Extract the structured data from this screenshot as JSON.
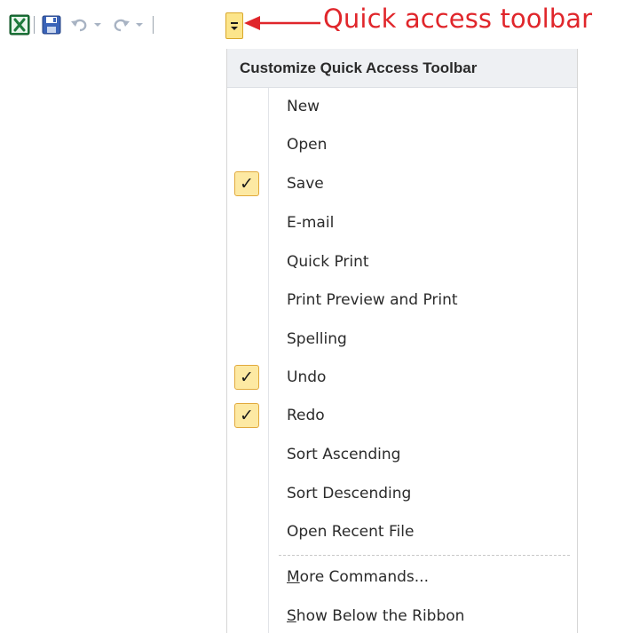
{
  "annotation": {
    "text": "Quick access toolbar",
    "color": "#e0262b"
  },
  "toolbar": {
    "icons": [
      "excel-icon",
      "save-icon",
      "undo-icon",
      "dropdown-arrow-icon",
      "redo-icon",
      "dropdown-arrow-icon",
      "customize-icon"
    ]
  },
  "menu": {
    "title": "Customize Quick Access Toolbar",
    "items": [
      {
        "label": "New",
        "checked": false
      },
      {
        "label": "Open",
        "checked": false
      },
      {
        "label": "Save",
        "checked": true
      },
      {
        "label": "E-mail",
        "checked": false
      },
      {
        "label": "Quick Print",
        "checked": false
      },
      {
        "label": "Print Preview and Print",
        "checked": false
      },
      {
        "label": "Spelling",
        "checked": false
      },
      {
        "label": "Undo",
        "checked": true
      },
      {
        "label": "Redo",
        "checked": true
      },
      {
        "label": "Sort Ascending",
        "checked": false
      },
      {
        "label": "Sort Descending",
        "checked": false
      },
      {
        "label": "Open Recent File",
        "checked": false
      }
    ],
    "more_commands": {
      "underline": "M",
      "rest": "ore Commands..."
    },
    "show_below": {
      "underline": "S",
      "rest": "how Below the Ribbon"
    },
    "check_glyph": "✓"
  }
}
